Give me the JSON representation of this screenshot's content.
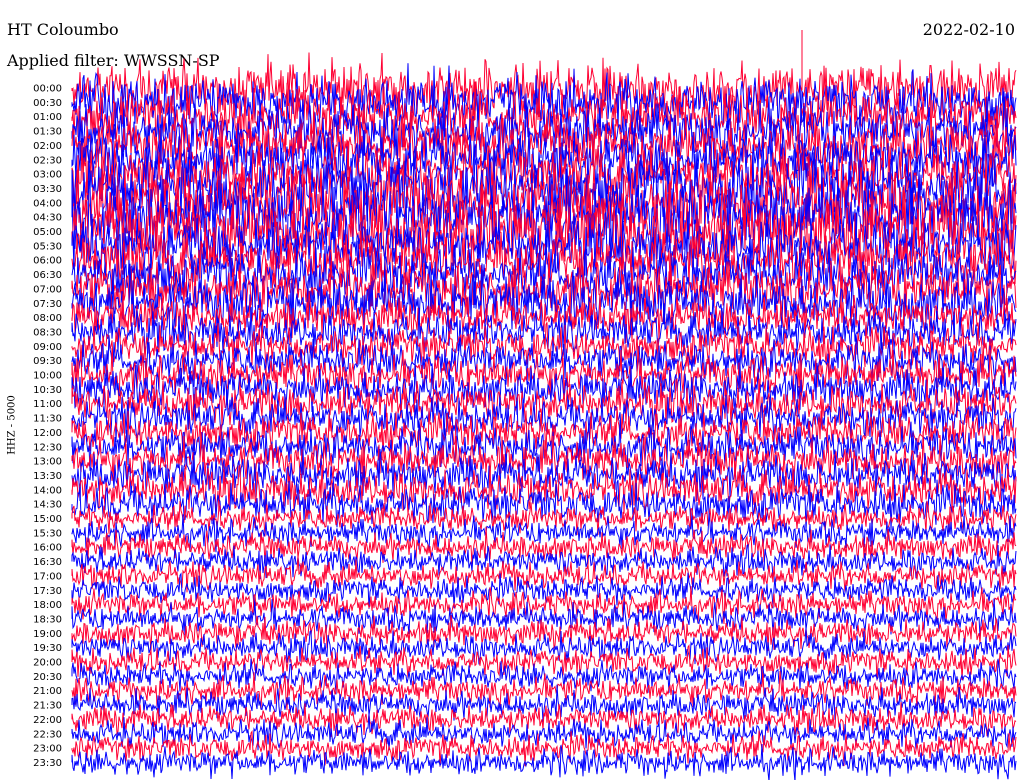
{
  "header": {
    "station": "HT Coloumbo",
    "date": "2022-02-10",
    "filter": "Applied filter: WWSSN-SP"
  },
  "chart_data": {
    "type": "line",
    "title": "HT Coloumbo",
    "ylabel": "HHZ - 5000",
    "row_labels": [
      "00:00",
      "00:30",
      "01:00",
      "01:30",
      "02:00",
      "02:30",
      "03:00",
      "03:30",
      "04:00",
      "04:30",
      "05:00",
      "05:30",
      "06:00",
      "06:30",
      "07:00",
      "07:30",
      "08:00",
      "08:30",
      "09:00",
      "09:30",
      "10:00",
      "10:30",
      "11:00",
      "11:30",
      "12:00",
      "12:30",
      "13:00",
      "13:30",
      "14:00",
      "14:30",
      "15:00",
      "15:30",
      "16:00",
      "16:30",
      "17:00",
      "17:30",
      "18:00",
      "18:30",
      "19:00",
      "19:30",
      "20:00",
      "20:30",
      "21:00",
      "21:30",
      "22:00",
      "22:30",
      "23:00",
      "23:30"
    ],
    "series_colors": [
      "#ff0033",
      "#0000ff"
    ],
    "grid": false
  }
}
